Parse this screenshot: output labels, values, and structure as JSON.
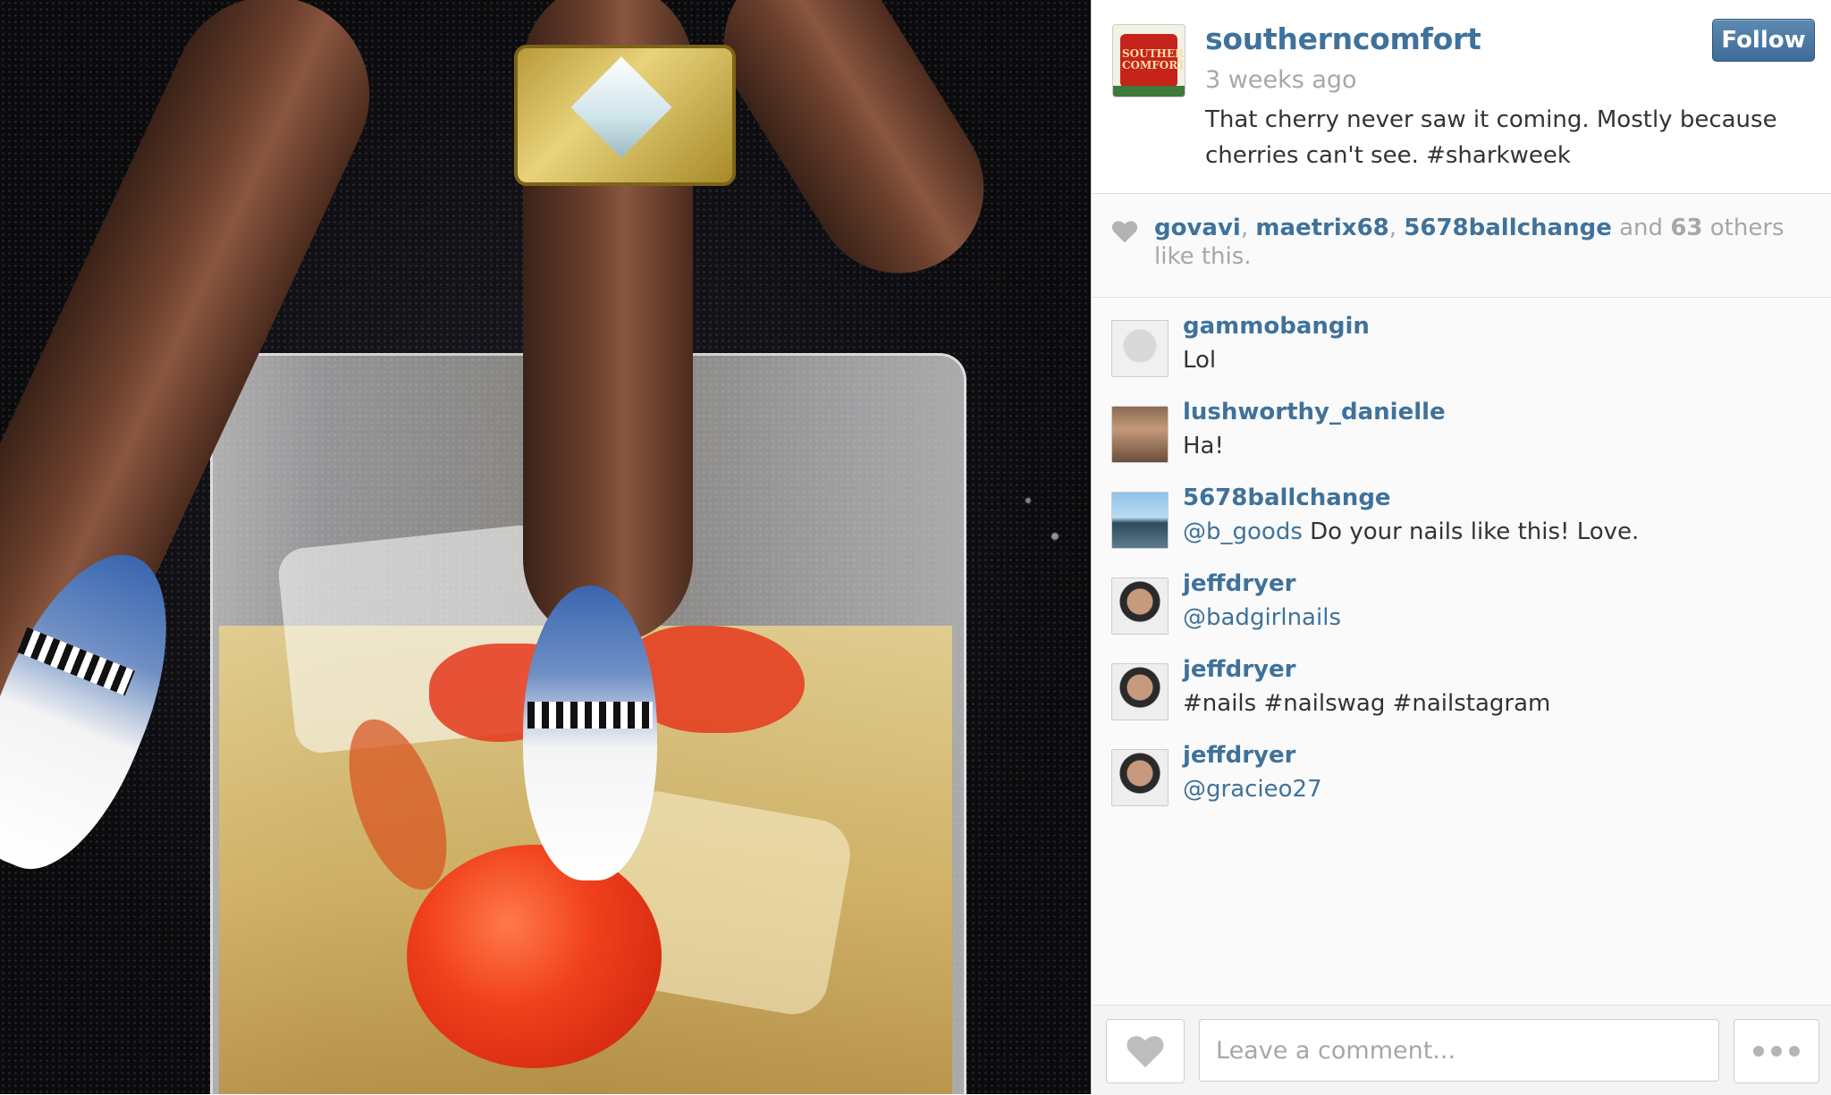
{
  "post": {
    "username": "southerncomfort",
    "avatar_label": "SOUTHERN COMFORT",
    "time_ago": "3 weeks ago",
    "caption": "That cherry never saw it coming. Mostly because cherries can't see. #sharkweek",
    "follow_label": "Follow"
  },
  "likes": {
    "users": [
      "govavi",
      "maetrix68",
      "5678ballchange"
    ],
    "and_label": "and",
    "others_count": "63",
    "others_label": "others like this."
  },
  "comments": [
    {
      "user": "gammobangin",
      "mention": "",
      "text": "Lol"
    },
    {
      "user": "lushworthy_danielle",
      "mention": "",
      "text": "Ha!"
    },
    {
      "user": "5678ballchange",
      "mention": "@b_goods",
      "text": "Do your nails like this! Love."
    },
    {
      "user": "jeffdryer",
      "mention": "@badgirlnails",
      "text": ""
    },
    {
      "user": "jeffdryer",
      "mention": "",
      "text": "#nails #nailswag #nailstagram"
    },
    {
      "user": "jeffdryer",
      "mention": "@gracieo27",
      "text": ""
    }
  ],
  "footer": {
    "comment_placeholder": "Leave a comment..."
  },
  "colors": {
    "link_blue": "#3f729b",
    "follow_button": "#4a79a6",
    "muted_text": "#a5a7aa"
  },
  "icons": {
    "like": "heart-icon",
    "more": "ellipsis-icon"
  }
}
